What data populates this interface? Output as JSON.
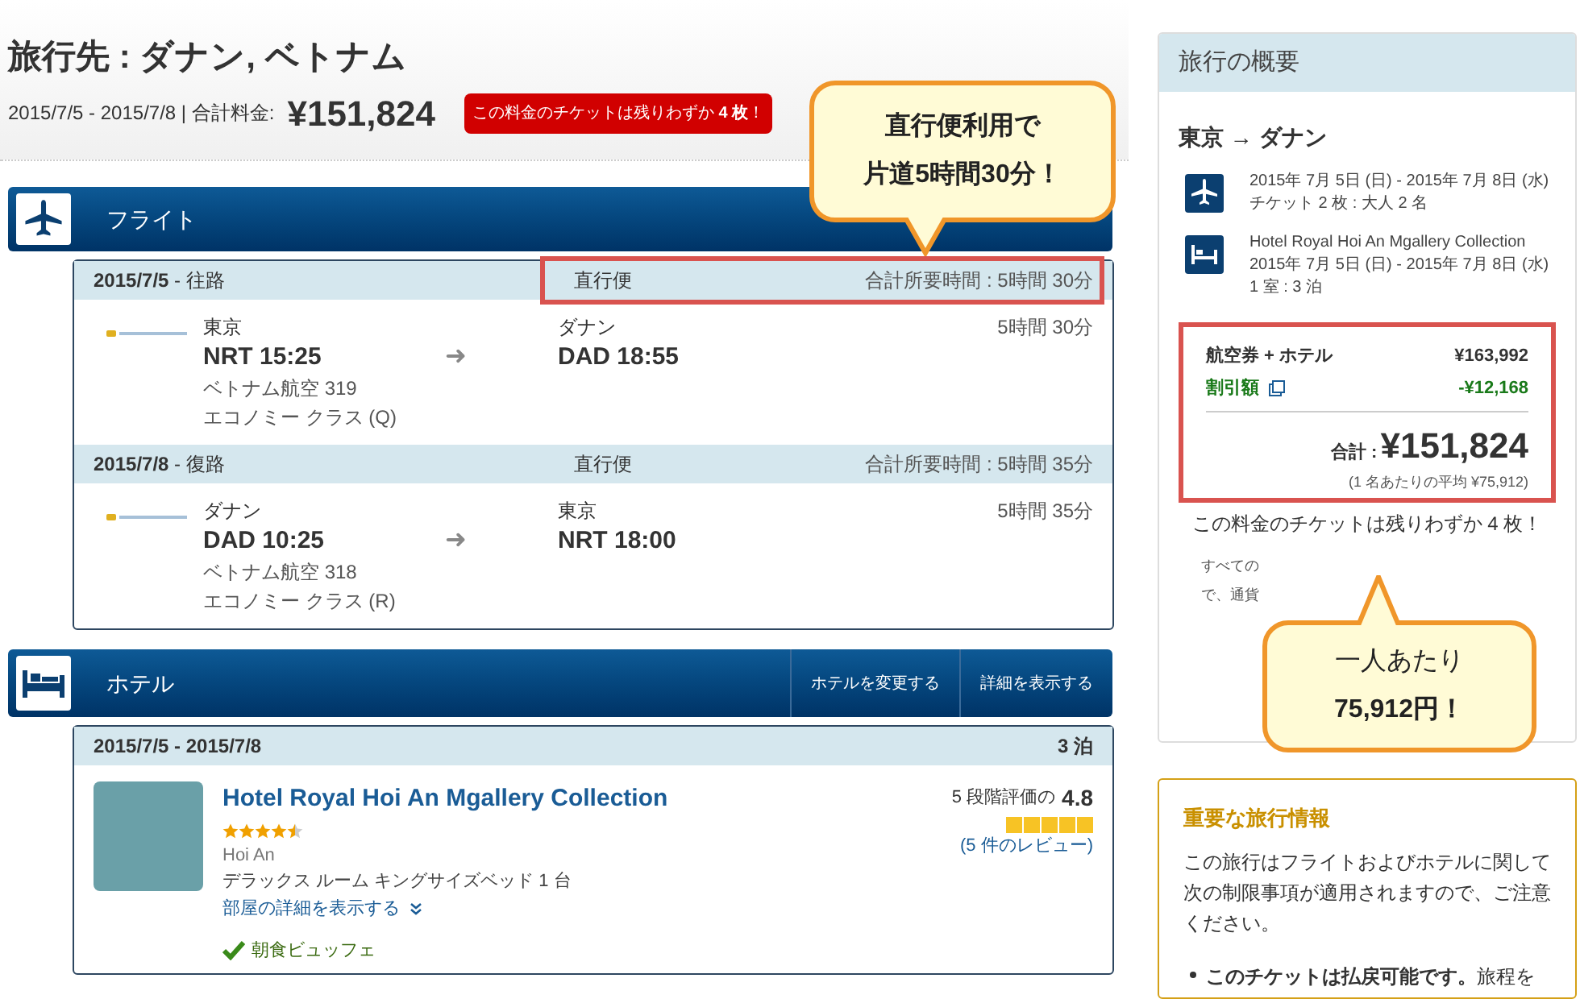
{
  "header": {
    "title": "旅行先 : ダナン, ベトナム",
    "dates": "2015/7/5 - 2015/7/8 | 合計料金:",
    "total": "¥151,824",
    "alert": "この料金のチケットは残りわずか **4 枚**！"
  },
  "flight_section": {
    "title": "フライト",
    "legs": [
      {
        "date": "**2015/7/5** - 往路",
        "type": "直行便",
        "total_time": "合計所要時間 : 5時間 30分",
        "highlight": true,
        "from_city": "東京",
        "from": "NRT 15:25",
        "airline": "ベトナム航空 319",
        "cabin": "エコノミー クラス (Q)",
        "arrow": "➜",
        "to_city": "ダナン",
        "to": "DAD 18:55",
        "duration": "5時間 30分"
      },
      {
        "date": "**2015/7/8** - 復路",
        "type": "直行便",
        "total_time": "合計所要時間 : 5時間 35分",
        "highlight": false,
        "from_city": "ダナン",
        "from": "DAD 10:25",
        "airline": "ベトナム航空 318",
        "cabin": "エコノミー クラス (R)",
        "arrow": "➜",
        "to_city": "東京",
        "to": "NRT 18:00",
        "duration": "5時間 35分"
      }
    ]
  },
  "hotel_section": {
    "title": "ホテル",
    "buttons": [
      "ホテルを変更する",
      "詳細を表示する"
    ],
    "dates": "2015/7/5 - 2015/7/8",
    "nights": "3 泊",
    "name": "Hotel Royal Hoi An Mgallery Collection",
    "stars": 4.5,
    "location": "Hoi An",
    "room": "デラックス ルーム キングサイズベッド 1 台",
    "details_link": "部屋の詳細を表示する",
    "review": {
      "label": "5 段階評価の",
      "score": "4.8",
      "stars": 5,
      "link": "(5 件のレビュー)"
    },
    "amenity": "朝食ビュッフェ"
  },
  "summary": {
    "title": "旅行の概要",
    "route": "東京 → ダナン",
    "flight": {
      "dates": "2015年 7月 5日 (日) - 2015年 7月 8日 (水)",
      "tickets": "チケット 2 枚 : 大人 2 名"
    },
    "hotel": {
      "name": "Hotel Royal Hoi An Mgallery Collection",
      "dates": "2015年 7月 5日 (日) - 2015年 7月 8日 (水)",
      "rooms": "1 室 : 3 泊"
    },
    "price_lines": [
      {
        "kind": "base",
        "label": "航空券 + ホテル",
        "amount": "¥163,992"
      },
      {
        "kind": "discount",
        "label": "割引額",
        "amount": "-¥12,168"
      }
    ],
    "total_label": "合計 :",
    "total": "¥151,824",
    "per_person": "(1 名あたりの平均 ¥75,912)",
    "alert": "この料金のチケットは残りわずか 4 枚！",
    "note_fragments": [
      "すべての",
      "で、通貨"
    ]
  },
  "important": {
    "title": "重要な旅行情報",
    "intro": "この旅行はフライトおよびホテルに関して次の制限事項が適用されますので、ご注意ください。",
    "bullets": [
      "**このチケットは払戻可能です。**旅程を"
    ]
  },
  "callouts": [
    {
      "lines": [
        {
          "text": "直行便利用で",
          "bold": true
        },
        {
          "text": "片道5時間30分！",
          "bold": true
        }
      ]
    },
    {
      "lines": [
        {
          "text": "一人あたり",
          "bold": false
        },
        {
          "text": "75,912円！",
          "bold": true
        }
      ]
    }
  ]
}
